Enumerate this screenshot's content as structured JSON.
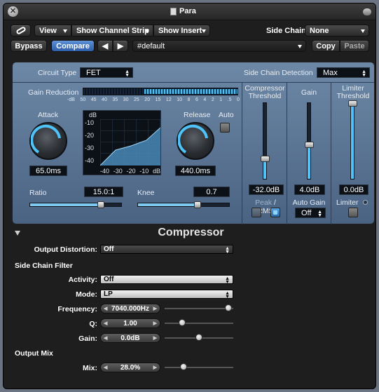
{
  "window": {
    "title": "Para"
  },
  "toolbar1": {
    "link_icon": "link-icon",
    "view_label": "View",
    "show_channel_strip_label": "Show Channel Strip",
    "show_insert_label": "Show Insert",
    "side_chain_label": "Side Chain:",
    "side_chain_value": "None"
  },
  "toolbar2": {
    "bypass_label": "Bypass",
    "compare_label": "Compare",
    "preset_name": "#default",
    "copy_label": "Copy",
    "paste_label": "Paste"
  },
  "panel": {
    "circuit_type_label": "Circuit Type",
    "circuit_type_value": "FET",
    "sidechain_detection_label": "Side Chain Detection",
    "sidechain_detection_value": "Max",
    "gain_reduction_label": "Gain Reduction",
    "meter_ticks": [
      "-dB",
      "50",
      "45",
      "40",
      "35",
      "30",
      "25",
      "20",
      "15",
      "12",
      "10",
      "8",
      "6",
      "4",
      "2",
      "1",
      ".5",
      "0"
    ],
    "attack_label": "Attack",
    "attack_value": "65.0ms",
    "release_label": "Release",
    "release_value": "440.0ms",
    "auto_label": "Auto",
    "graph_y_unit": "dB",
    "graph_y_ticks": [
      "-10",
      "-20",
      "-30",
      "-40"
    ],
    "graph_x_ticks": [
      "-40",
      "-30",
      "-20",
      "-10",
      "dB"
    ],
    "ratio_label": "Ratio",
    "ratio_value": "15.0:1",
    "knee_label": "Knee",
    "knee_value": "0.7",
    "ratio_slider_fraction": 0.78,
    "knee_slider_fraction": 0.65,
    "comp_threshold_label_line1": "Compressor",
    "comp_threshold_label_line2": "Threshold",
    "comp_threshold_value": "-32.0dB",
    "comp_threshold_fraction": 0.27,
    "peak_rms_label_peak": "Peak",
    "peak_rms_label_sep": "/",
    "peak_rms_label_rms": "RMS",
    "gain_label": "Gain",
    "gain_value": "4.0dB",
    "gain_fraction": 0.45,
    "auto_gain_label": "Auto Gain",
    "auto_gain_value": "Off",
    "limiter_threshold_label_line1": "Limiter",
    "limiter_threshold_label_line2": "Threshold",
    "limiter_threshold_value": "0.0dB",
    "limiter_threshold_fraction": 1.0,
    "limiter_label": "Limiter"
  },
  "lower": {
    "section_title": "Compressor",
    "output_distortion_label": "Output Distortion:",
    "output_distortion_value": "Off",
    "side_chain_filter_heading": "Side Chain Filter",
    "activity_label": "Activity:",
    "activity_value": "Off",
    "mode_label": "Mode:",
    "mode_value": "LP",
    "frequency_label": "Frequency:",
    "frequency_value": "7040.000Hz",
    "frequency_fraction": 0.93,
    "q_label": "Q:",
    "q_value": "1.00",
    "q_fraction": 0.25,
    "gain_label": "Gain:",
    "gain_value": "0.0dB",
    "gain_fraction": 0.5,
    "output_mix_heading": "Output Mix",
    "mix_label": "Mix:",
    "mix_value": "28.0%",
    "mix_fraction": 0.28
  },
  "colors": {
    "accent": "#4fc3f7",
    "panel_top": "#6d88a6",
    "panel_bottom": "#4b6383"
  }
}
